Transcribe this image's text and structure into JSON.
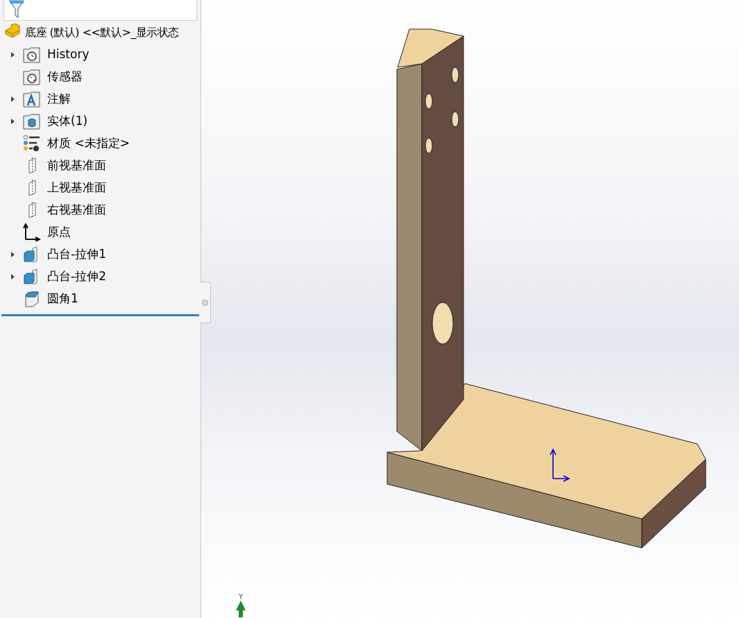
{
  "feature_tree": {
    "root": {
      "label": "底座 (默认) <<默认>_显示状态"
    },
    "items": [
      {
        "kind": "history",
        "label": "History",
        "expanded": false
      },
      {
        "kind": "sensor",
        "label": "传感器"
      },
      {
        "kind": "annotation",
        "label": "注解",
        "expanded": false
      },
      {
        "kind": "solid",
        "label": "实体(1)",
        "expanded": false
      },
      {
        "kind": "material",
        "label": "材质 <未指定>"
      },
      {
        "kind": "plane",
        "label": "前视基准面"
      },
      {
        "kind": "plane",
        "label": "上视基准面"
      },
      {
        "kind": "plane",
        "label": "右视基准面"
      },
      {
        "kind": "origin",
        "label": "原点"
      },
      {
        "kind": "extrude",
        "label": "凸台-拉伸1",
        "expanded": false
      },
      {
        "kind": "extrude",
        "label": "凸台-拉伸2",
        "expanded": false
      },
      {
        "kind": "fillet",
        "label": "圆角1"
      }
    ]
  },
  "viewport": {
    "triad_label": "Y"
  }
}
